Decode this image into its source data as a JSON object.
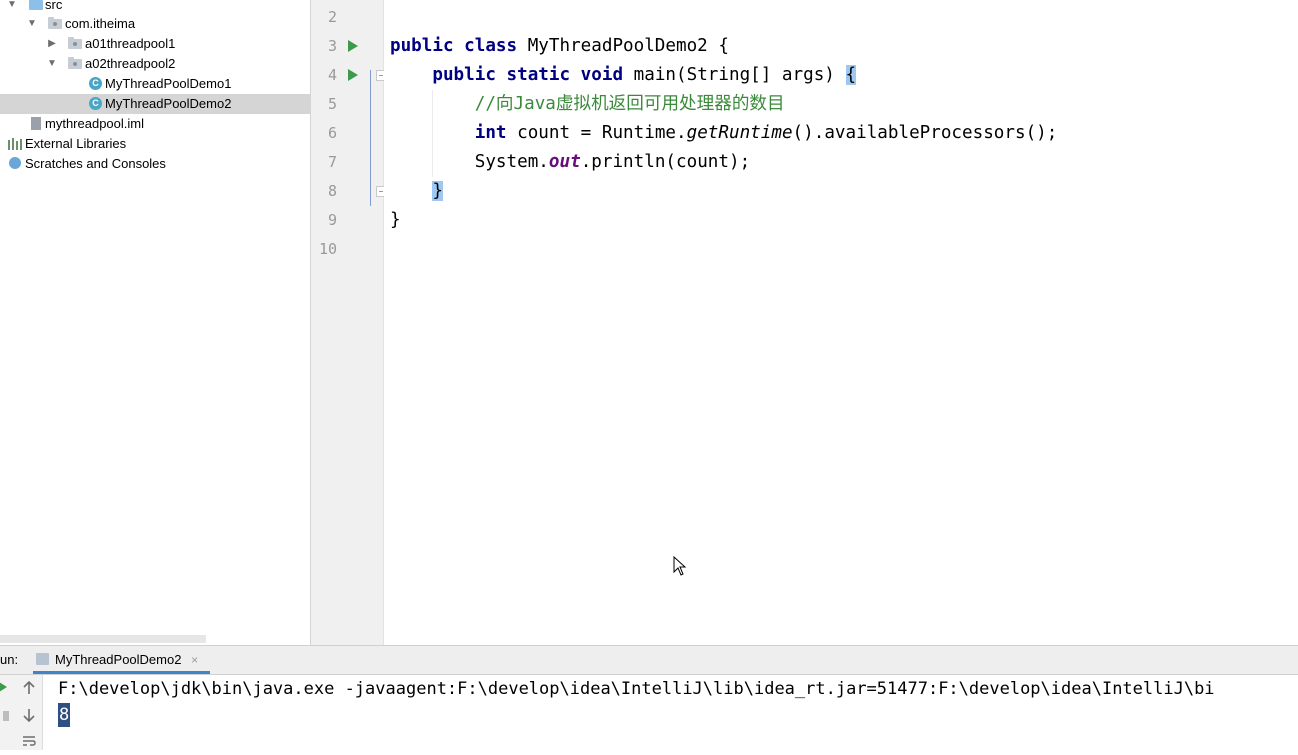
{
  "project_tree": {
    "items": [
      {
        "label": "src",
        "expanded": true
      },
      {
        "label": "com.itheima",
        "expanded": true
      },
      {
        "label": "a01threadpool1",
        "expanded": false
      },
      {
        "label": "a02threadpool2",
        "expanded": true
      },
      {
        "label": "MyThreadPoolDemo1"
      },
      {
        "label": "MyThreadPoolDemo2",
        "selected": true
      },
      {
        "label": "mythreadpool.iml"
      },
      {
        "label": "External Libraries"
      },
      {
        "label": "Scratches and Consoles"
      }
    ]
  },
  "editor": {
    "line_numbers": [
      "2",
      "3",
      "4",
      "5",
      "6",
      "7",
      "8",
      "9",
      "10"
    ],
    "code": {
      "l3_kw": "public class",
      "l3_rest": " MyThreadPoolDemo2 {",
      "l4_kw": "public static void",
      "l4_rest": " main(String[] args) ",
      "l4_brace": "{",
      "l5_comment": "//向Java虚拟机返回可用处理器的数目",
      "l6_kw": "int",
      "l6_a": " count = Runtime.",
      "l6_method": "getRuntime",
      "l6_b": "().availableProcessors();",
      "l7_a": "System.",
      "l7_field": "out",
      "l7_b": ".println(count);",
      "l8_brace": "}",
      "l9": "}"
    }
  },
  "run_panel": {
    "label": "un:",
    "tab": "MyThreadPoolDemo2",
    "tab_close": "×",
    "command": "F:\\develop\\jdk\\bin\\java.exe -javaagent:F:\\develop\\idea\\IntelliJ\\lib\\idea_rt.jar=51477:F:\\develop\\idea\\IntelliJ\\bi",
    "output": "8"
  },
  "colors": {
    "keyword": "#000080",
    "comment": "#3b8a3b",
    "field": "#660e7a",
    "selection": "#d5d5d5",
    "current_line": "#fdf8e2"
  }
}
